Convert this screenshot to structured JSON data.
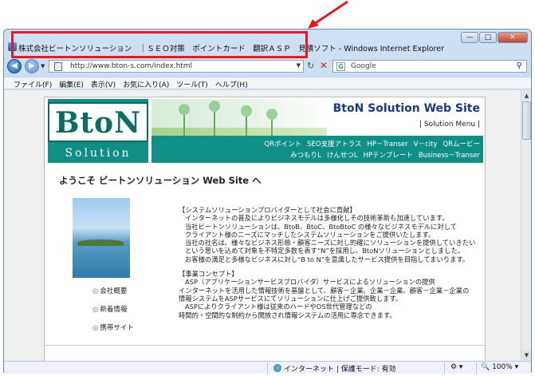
{
  "window": {
    "title": "株式会社ビートンソリューション　｜ＳＥＯ対策　ポイントカード　翻訳ＡＳＰ　見積ソフト - Windows Internet Explorer",
    "minimize": "—",
    "maximize": "□",
    "close": "✕"
  },
  "address": {
    "url": "http://www.bton-s.com/index.html",
    "search_placeholder": "Google"
  },
  "menu": [
    "ファイル(F)",
    "編集(E)",
    "表示(V)",
    "お気に入り(A)",
    "ツール(T)",
    "ヘルプ(H)"
  ],
  "site": {
    "logo_main": "BtoN",
    "logo_sub": "Solution",
    "title": "BtoN Solution Web Site",
    "menu_label": "| Solution Menu |",
    "nav_row1": [
      "QRポイント",
      "SEO支援アトラス",
      "HP－Transer",
      "V－city",
      "QRムービー"
    ],
    "nav_row2": [
      "みつもりL",
      "けんせつL",
      "HPテンプレート",
      "Business－Transer"
    ],
    "welcome": "ようこそ ビートンソリューション Web Site へ",
    "side_links": [
      "会社概要",
      "新着情報",
      "携帯サイト"
    ],
    "intro_heading": "【システムソリューションプロバイダーとして社会に貢献】",
    "intro_lines": [
      "インターネットの普及によりビジネスモデルは多様化しその技術革新も加速しています。",
      "当社ビートンソリューションは、BtoB、BtoC、BtoBtoC の様々なビジネスモデルに対して",
      "クライアント様のニーズにマッチしたシステムソリューションをご提供いたします。",
      "当社の社名は、様々なビジネス形態・顧客ニーズに対し的確にソリューションを提供していきたい",
      "という思いを込めて対象を不特定多数を表す“N”を採用し、BtoNソリューションとしました。",
      "お客様の満足と多様なビジネスに対し“B to N”を意識したサービス提供を目指してまいります。"
    ],
    "concept_heading": "【事業コンセプト】",
    "concept_lines": [
      "ASP（アプリケーションサービスプロバイダ）サービスによるソリューションの提供",
      "インターネットを活用した情報技術を基盤として、顧客－企業、企業－企業、顧客－企業－企業の",
      "情報システムをASPサービスにてソリューションに仕上げご提供致します。",
      "ASPによりクライアント様は従来のハードやOS世代管理などの",
      "時間的・空間的な制約から開放され情報システムの活用に専念できます。"
    ]
  },
  "status": {
    "zone": "インターネット | 保護モード: 有効",
    "zoom": "100%"
  },
  "annotation": {
    "color": "#e31b23"
  }
}
